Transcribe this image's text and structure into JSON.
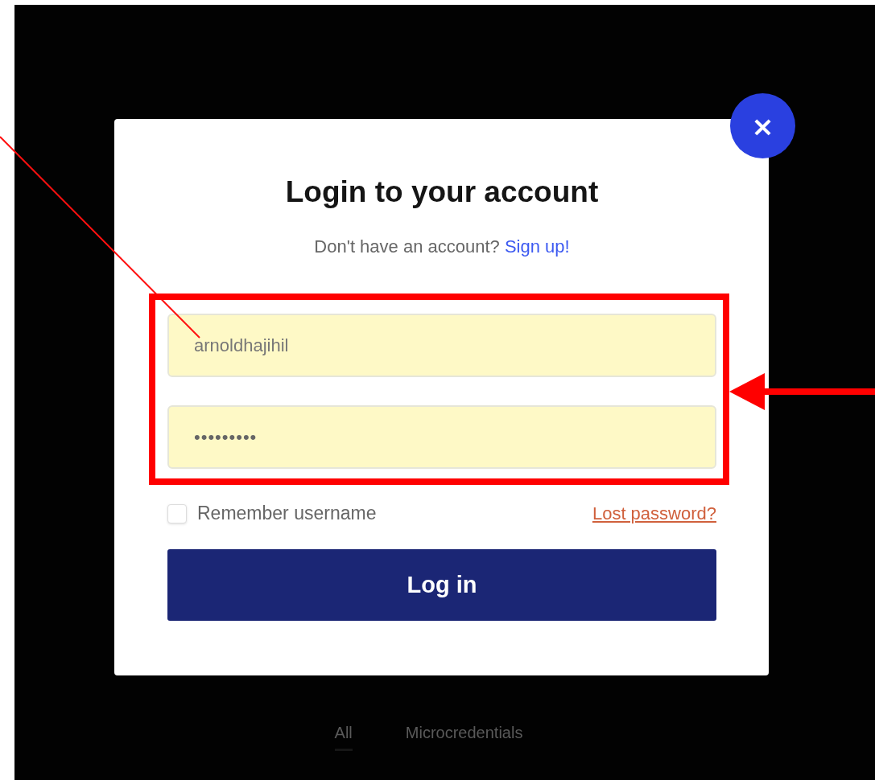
{
  "background_tabs": [
    {
      "label": "All",
      "selected": true
    },
    {
      "label": "Microcredentials",
      "selected": false
    }
  ],
  "dialog": {
    "close_button": "×",
    "title": "Login to your account",
    "subtitle": "Don't have an account?",
    "signup_link": "Sign up!",
    "username_field": {
      "value": "arnoldhajihil"
    },
    "password_field": {
      "value": "•••••••••"
    },
    "remember": {
      "label": "Remember username",
      "checked": false
    },
    "lost_password_link": "Lost password?",
    "login_button": "Log in"
  }
}
